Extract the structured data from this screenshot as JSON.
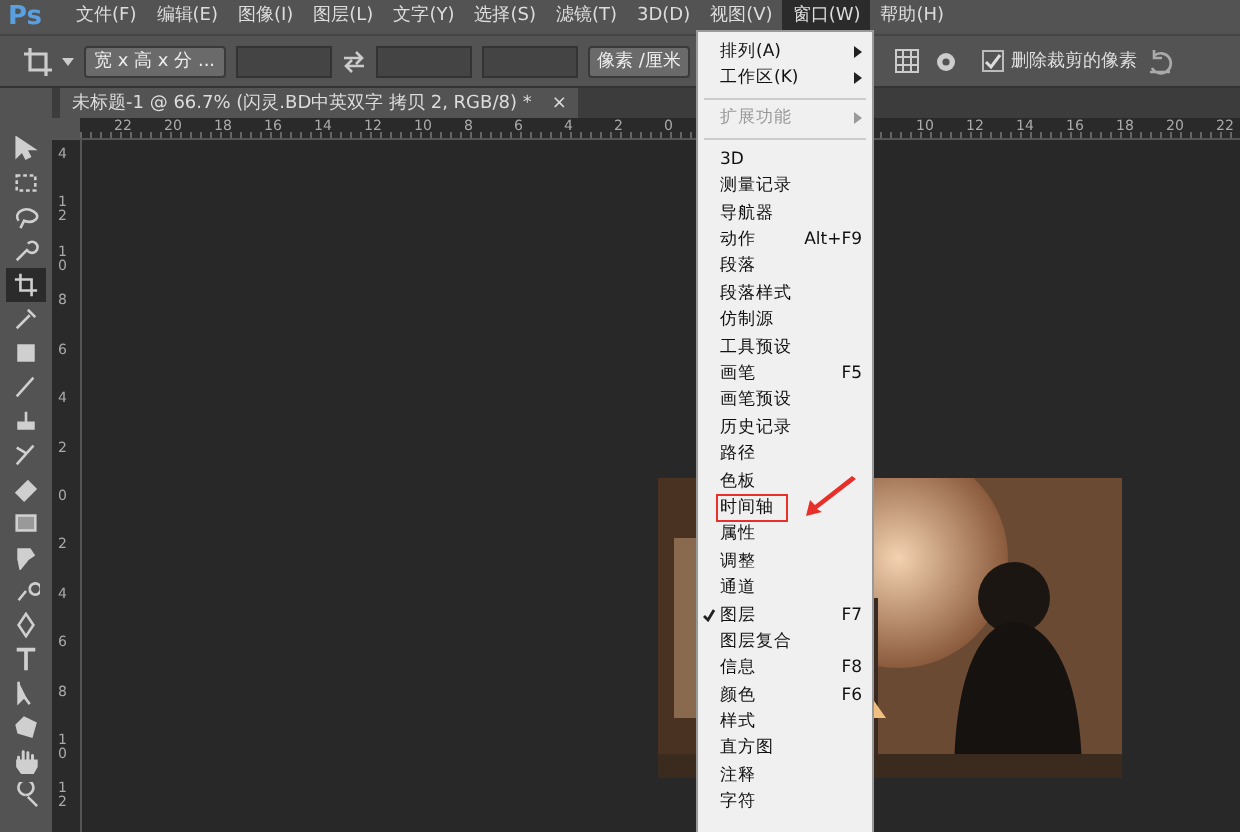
{
  "app_logo": "Ps",
  "menu_bar": [
    {
      "label": "文件(F)",
      "selected": false
    },
    {
      "label": "编辑(E)",
      "selected": false
    },
    {
      "label": "图像(I)",
      "selected": false
    },
    {
      "label": "图层(L)",
      "selected": false
    },
    {
      "label": "文字(Y)",
      "selected": false
    },
    {
      "label": "选择(S)",
      "selected": false
    },
    {
      "label": "滤镜(T)",
      "selected": false
    },
    {
      "label": "3D(D)",
      "selected": false
    },
    {
      "label": "视图(V)",
      "selected": false
    },
    {
      "label": "窗口(W)",
      "selected": true
    },
    {
      "label": "帮助(H)",
      "selected": false
    }
  ],
  "options_bar": {
    "ratio_dropdown": "宽 x 高 x 分 ...",
    "unit_dropdown": "像素 /厘米",
    "delete_cropped": {
      "label": "删除裁剪的像素",
      "checked": true
    }
  },
  "document_tab": {
    "title": "未标题-1 @ 66.7% (闪灵.BD中英双字 拷贝 2, RGB/8) *",
    "close": "×"
  },
  "ruler_top": {
    "left_labels": [
      "22",
      "20",
      "18",
      "16",
      "14",
      "12",
      "10",
      "8",
      "6",
      "4",
      "2",
      "0"
    ],
    "right_labels": [
      "10",
      "12",
      "14",
      "16",
      "18",
      "20",
      "22"
    ]
  },
  "ruler_left": {
    "labels": [
      "4",
      "12",
      "10",
      "8",
      "6",
      "4",
      "2",
      "0",
      "2",
      "4",
      "6",
      "8",
      "10",
      "12"
    ]
  },
  "tools": [
    {
      "selected": false
    },
    {
      "selected": false
    },
    {
      "selected": false
    },
    {
      "selected": false
    },
    {
      "selected": true
    },
    {
      "selected": false
    },
    {
      "selected": false
    },
    {
      "selected": false
    },
    {
      "selected": false
    },
    {
      "selected": false
    },
    {
      "selected": false
    },
    {
      "selected": false
    },
    {
      "selected": false
    },
    {
      "selected": false
    },
    {
      "selected": false
    },
    {
      "selected": false
    },
    {
      "selected": false
    },
    {
      "selected": false
    },
    {
      "selected": false
    },
    {
      "selected": false
    }
  ],
  "window_menu": [
    {
      "label": "排列(A)",
      "submenu": true,
      "disabled": false,
      "checked": false,
      "highlighted": false
    },
    {
      "label": "工作区(K)",
      "submenu": true,
      "disabled": false,
      "checked": false,
      "highlighted": false,
      "separator_after": true
    },
    {
      "label": "扩展功能",
      "submenu": true,
      "disabled": true,
      "checked": false,
      "highlighted": false,
      "separator_after": true
    },
    {
      "label": "3D",
      "submenu": false,
      "disabled": false,
      "checked": false,
      "highlighted": false
    },
    {
      "label": "测量记录",
      "submenu": false,
      "disabled": false,
      "checked": false,
      "highlighted": false
    },
    {
      "label": "导航器",
      "submenu": false,
      "disabled": false,
      "checked": false,
      "highlighted": false
    },
    {
      "label": "动作",
      "shortcut": "Alt+F9",
      "submenu": false,
      "disabled": false,
      "checked": false,
      "highlighted": false
    },
    {
      "label": "段落",
      "submenu": false,
      "disabled": false,
      "checked": false,
      "highlighted": false
    },
    {
      "label": "段落样式",
      "submenu": false,
      "disabled": false,
      "checked": false,
      "highlighted": false
    },
    {
      "label": "仿制源",
      "submenu": false,
      "disabled": false,
      "checked": false,
      "highlighted": false
    },
    {
      "label": "工具预设",
      "submenu": false,
      "disabled": false,
      "checked": false,
      "highlighted": false
    },
    {
      "label": "画笔",
      "shortcut": "F5",
      "submenu": false,
      "disabled": false,
      "checked": false,
      "highlighted": false
    },
    {
      "label": "画笔预设",
      "submenu": false,
      "disabled": false,
      "checked": false,
      "highlighted": false
    },
    {
      "label": "历史记录",
      "submenu": false,
      "disabled": false,
      "checked": false,
      "highlighted": false
    },
    {
      "label": "路径",
      "submenu": false,
      "disabled": false,
      "checked": false,
      "highlighted": false
    },
    {
      "label": "色板",
      "submenu": false,
      "disabled": false,
      "checked": false,
      "highlighted": false
    },
    {
      "label": "时间轴",
      "submenu": false,
      "disabled": false,
      "checked": false,
      "highlighted": true
    },
    {
      "label": "属性",
      "submenu": false,
      "disabled": false,
      "checked": false,
      "highlighted": false
    },
    {
      "label": "调整",
      "submenu": false,
      "disabled": false,
      "checked": false,
      "highlighted": false
    },
    {
      "label": "通道",
      "submenu": false,
      "disabled": false,
      "checked": false,
      "highlighted": false
    },
    {
      "label": "图层",
      "shortcut": "F7",
      "submenu": false,
      "disabled": false,
      "checked": true,
      "highlighted": false
    },
    {
      "label": "图层复合",
      "submenu": false,
      "disabled": false,
      "checked": false,
      "highlighted": false
    },
    {
      "label": "信息",
      "shortcut": "F8",
      "submenu": false,
      "disabled": false,
      "checked": false,
      "highlighted": false
    },
    {
      "label": "颜色",
      "shortcut": "F6",
      "submenu": false,
      "disabled": false,
      "checked": false,
      "highlighted": false
    },
    {
      "label": "样式",
      "submenu": false,
      "disabled": false,
      "checked": false,
      "highlighted": false
    },
    {
      "label": "直方图",
      "submenu": false,
      "disabled": false,
      "checked": false,
      "highlighted": false
    },
    {
      "label": "注释",
      "submenu": false,
      "disabled": false,
      "checked": false,
      "highlighted": false
    },
    {
      "label": "字符",
      "submenu": false,
      "disabled": false,
      "checked": false,
      "highlighted": false
    }
  ]
}
